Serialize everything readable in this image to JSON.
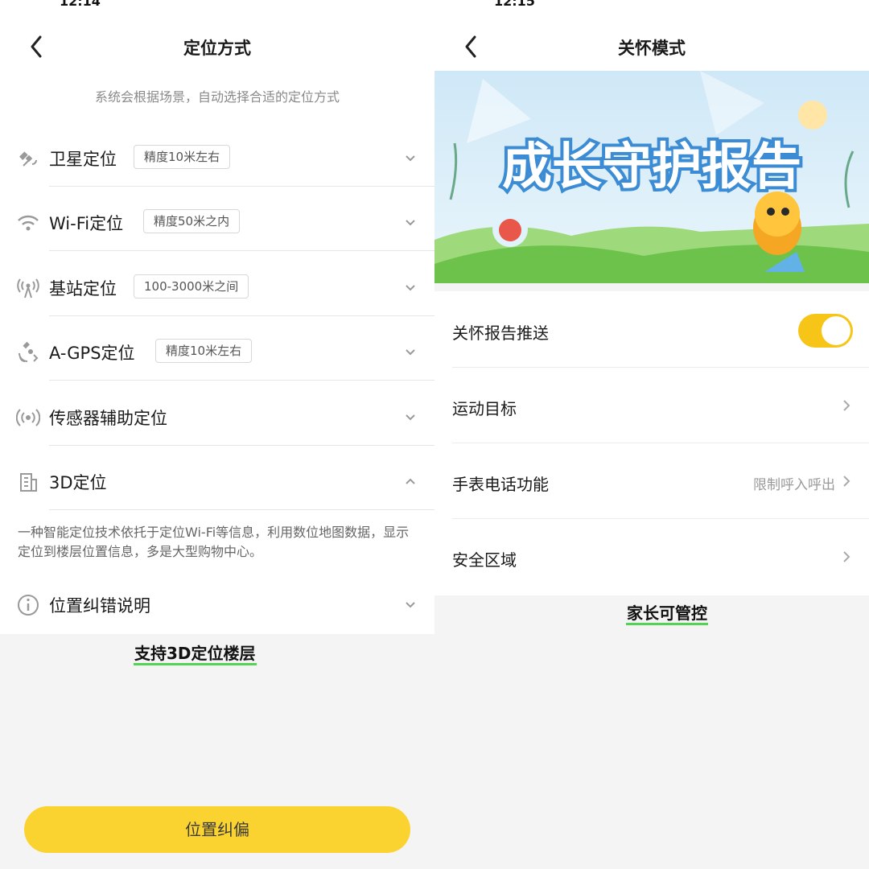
{
  "left": {
    "status_time": "12:14",
    "title": "定位方式",
    "subtitle": "系统会根据场景，自动选择合适的定位方式",
    "rows": [
      {
        "label": "卫星定位",
        "tag": "精度10米左右",
        "icon": "satellite-icon",
        "chevron": "down"
      },
      {
        "label": "Wi-Fi定位",
        "tag": "精度50米之内",
        "icon": "wifi-icon",
        "chevron": "down"
      },
      {
        "label": "基站定位",
        "tag": "100-3000米之间",
        "icon": "cell-tower-icon",
        "chevron": "down"
      },
      {
        "label": "A-GPS定位",
        "tag": "精度10米左右",
        "icon": "agps-icon",
        "chevron": "down"
      },
      {
        "label": "传感器辅助定位",
        "tag": "",
        "icon": "sensor-icon",
        "chevron": "down"
      },
      {
        "label": "3D定位",
        "tag": "",
        "icon": "building-icon",
        "chevron": "up"
      }
    ],
    "desc_3d": "一种智能定位技术依托于定位Wi-Fi等信息，利用数位地图数据，显示定位到楼层位置信息，多是大型购物中心。",
    "correction_label": "位置纠错说明",
    "caption": "支持3D定位楼层",
    "button": "位置纠偏"
  },
  "right": {
    "status_time": "12:15",
    "title": "关怀模式",
    "banner_title": "成长守护报告",
    "rows": [
      {
        "label": "关怀报告推送",
        "value": "",
        "toggle": true
      },
      {
        "label": "运动目标",
        "value": ""
      },
      {
        "label": "手表电话功能",
        "value": "限制呼入呼出"
      },
      {
        "label": "安全区域",
        "value": ""
      }
    ],
    "caption": "家长可管控"
  },
  "colors": {
    "accent_yellow": "#fbd331",
    "toggle_on": "#f7c518",
    "caption_underline": "#52d452",
    "banner_sky": "#cfe8f7",
    "banner_grass": "#7ccb5a"
  }
}
